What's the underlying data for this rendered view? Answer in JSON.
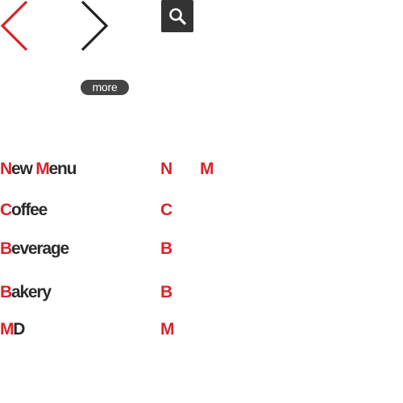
{
  "colors": {
    "accent": "#d8232a",
    "text": "#2a2a2a",
    "button_dark": "#333333"
  },
  "navigation": {
    "prev_icon": "chevron-left-icon",
    "next_icon": "chevron-right-icon",
    "search_icon": "magnifier-icon"
  },
  "more_button": {
    "label": "more"
  },
  "menu": [
    {
      "parts": [
        "N",
        "ew ",
        "M",
        "enu"
      ],
      "initials": [
        "N",
        "M"
      ]
    },
    {
      "parts": [
        "C",
        "offee"
      ],
      "initials": [
        "C"
      ]
    },
    {
      "parts": [
        "B",
        "everage"
      ],
      "initials": [
        "B"
      ]
    },
    {
      "parts": [
        "B",
        "akery"
      ],
      "initials": [
        "B"
      ]
    },
    {
      "parts": [
        "M",
        "D"
      ],
      "initials": [
        "M"
      ]
    }
  ]
}
